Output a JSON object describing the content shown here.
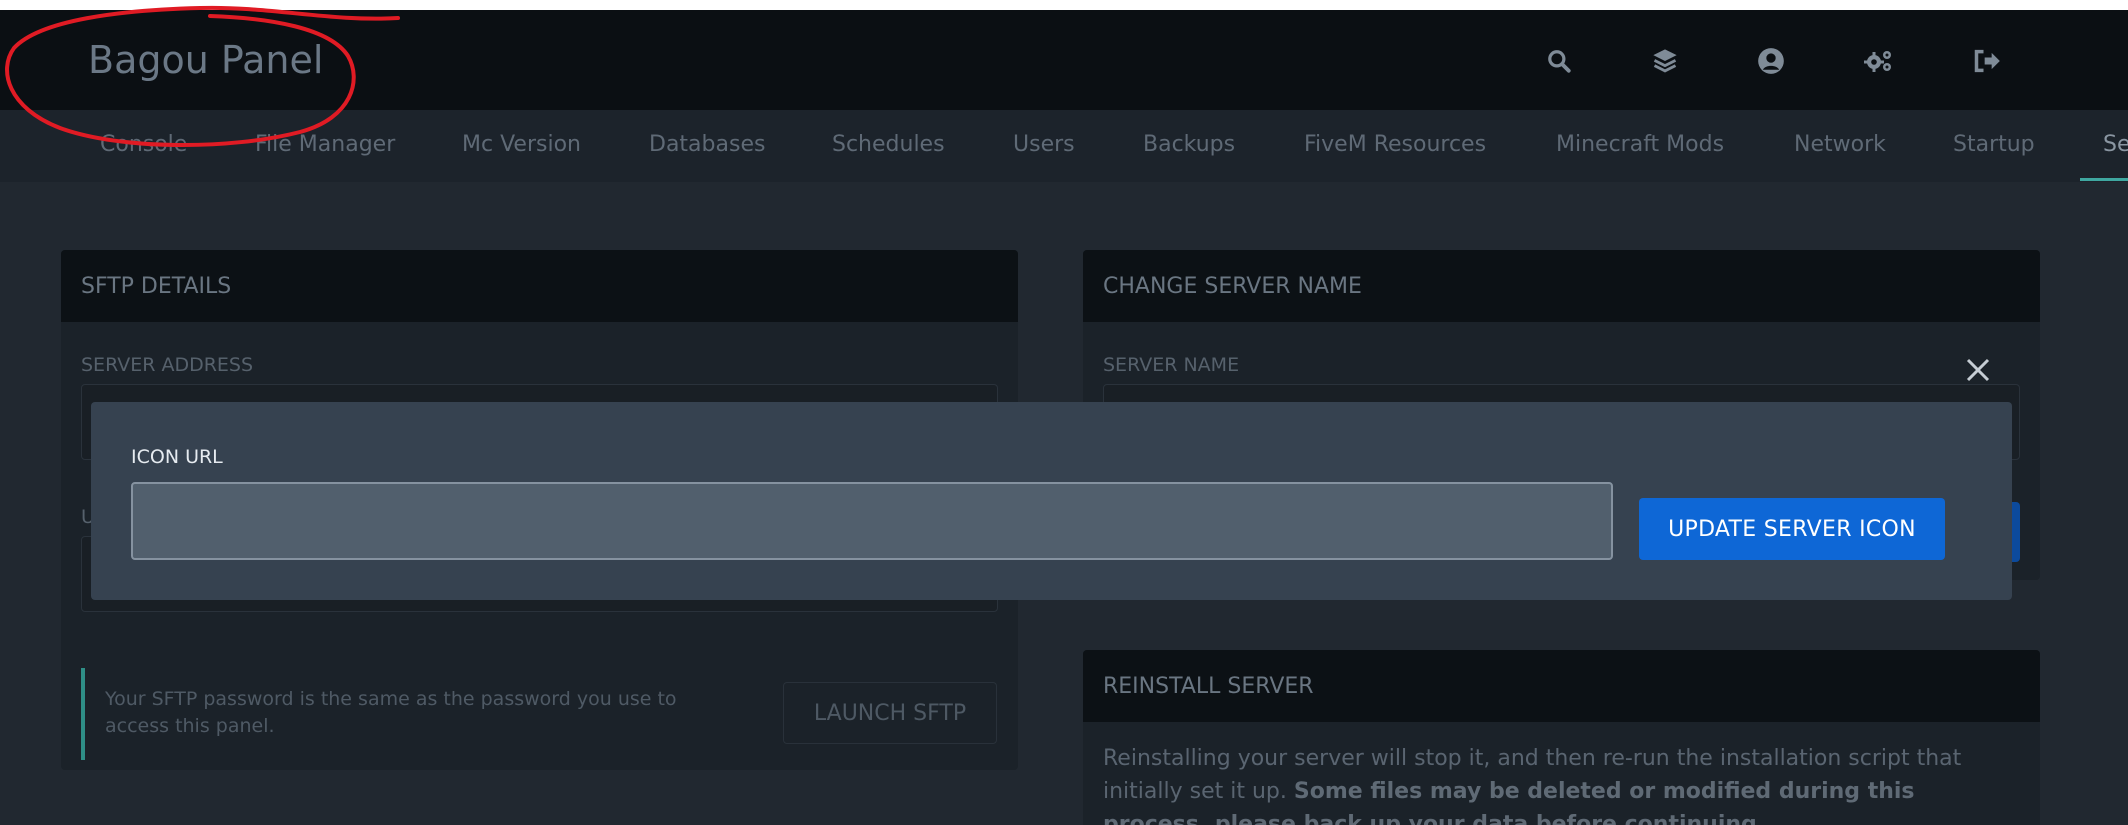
{
  "header": {
    "brand": "Bagou Panel",
    "icons": [
      "search-icon",
      "layers-icon",
      "user-circle-icon",
      "cogs-icon",
      "sign-out-icon"
    ]
  },
  "tabs": [
    {
      "label": "Console"
    },
    {
      "label": "File Manager"
    },
    {
      "label": "Mc Version"
    },
    {
      "label": "Databases"
    },
    {
      "label": "Schedules"
    },
    {
      "label": "Users"
    },
    {
      "label": "Backups"
    },
    {
      "label": "FiveM Resources"
    },
    {
      "label": "Minecraft Mods"
    },
    {
      "label": "Network"
    },
    {
      "label": "Startup"
    },
    {
      "label": "Se",
      "active": true
    }
  ],
  "sftp": {
    "title": "SFTP DETAILS",
    "server_address_label": "SERVER ADDRESS",
    "username_label_partial": "U",
    "note": "Your SFTP password is the same as the password you use to access this panel.",
    "launch_button": "LAUNCH SFTP"
  },
  "change_name": {
    "title": "CHANGE SERVER NAME",
    "server_name_label": "SERVER NAME"
  },
  "reinstall": {
    "title": "REINSTALL SERVER",
    "text_normal": "Reinstalling your server will stop it, and then re-run the installation script that initially set it up. ",
    "text_bold": "Some files may be deleted or modified during this process, please back up your data before continuing."
  },
  "modal": {
    "field_label": "ICON URL",
    "input_value": "",
    "input_placeholder": "",
    "submit_button": "UPDATE SERVER ICON"
  },
  "colors": {
    "accent_blue": "#0e67d6",
    "annotation_red": "#e01b24",
    "tab_underline": "#3fa7a0"
  }
}
